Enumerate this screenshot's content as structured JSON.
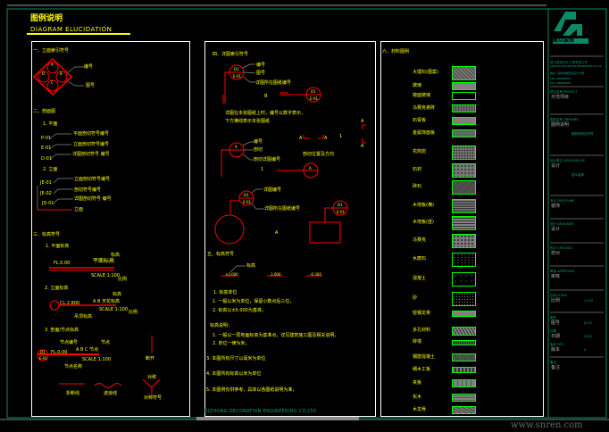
{
  "title": {
    "cn": "图例说明",
    "en": "DIAGRAM ELUCIDATION"
  },
  "left": {
    "s1": "一、立面索引符号",
    "s1_labels": [
      "编号",
      "图号"
    ],
    "diamond": [
      "A",
      "B",
      "C",
      "D",
      "E-01",
      "E-02",
      "E-03",
      "E-04"
    ],
    "s2": "二、剖面图",
    "s2_plan": "1. 平面",
    "plan_codes": [
      "P-01",
      "E-01",
      "D-01"
    ],
    "plan_labels": [
      "平面剖切符号编号",
      "立面剖切符号编号",
      "详图剖切符号 编号"
    ],
    "s2_elev": "2. 立面",
    "elev_codes": [
      "JE-01",
      "JE-02",
      "JD-01"
    ],
    "elev_labels": [
      "立面剖切符号编号",
      "剖切符号编号",
      "详图剖切符号 编号"
    ],
    "elev_last": "立面",
    "s3": "三、标高符号",
    "lv1": "1. 平面标高",
    "lv1_val": "FL.0.00",
    "lv1_mark": "平面标高",
    "lv1_note": "标高",
    "lv1_sub": "SCALE 1:100",
    "lv1_r": "比例",
    "lv2": "2. 立面标高",
    "lv2_val": "CL.2.800",
    "lv2_mark": "A  B  天花标高",
    "lv2_note": "标高",
    "lv2_sub": "SCALE 1:100",
    "lv2_r": "比例",
    "lv2_l": "吊顶标高",
    "lv3": "3. 剖面/节点标高",
    "lv3_code": "D1",
    "lv3_code2": "E-01",
    "lv3_val": "FL.0.00",
    "lv3_mark": "A  B  C  节点",
    "lv3_note": "节点",
    "lv3_sub": "SCALE 1:100",
    "lv3_l": "节点编号",
    "lv3_r": "节点名称",
    "side": "断开",
    "sym": [
      "折断线",
      "波浪线",
      "对称符号"
    ],
    "sym_top": "对称"
  },
  "middle": {
    "s4": "四、详图索引符号",
    "idx_code": "D1",
    "idx_page": "E-01",
    "idx_labels": [
      "编号",
      "图号",
      "详图所在图纸编号"
    ],
    "idx_b": "B",
    "note1": "详图在本张图纸上时，编号以数字表示，",
    "note2": "下方横线表示本张图纸",
    "sec_code": "A",
    "sec_labels": [
      "编号",
      "剖切",
      "剖切详图编号"
    ],
    "sec_num": "1",
    "cut_a": "A",
    "cut_b": "A",
    "cut_n": "1",
    "cut_note": "剖切位置及方向",
    "side_a": "A",
    "side_b": "A",
    "det_code": "D1",
    "det_page": "E-01",
    "det_labels": [
      "详图编号",
      "详图所在图纸编号"
    ],
    "circle_a": "A",
    "s5": "五、标高符号",
    "lv_note": "标高",
    "lv_vals": [
      "±0.000",
      "3.000",
      "-0.300"
    ],
    "n_head": "1. 标高单位",
    "n1": "1. 一般以米为单位，保留小数点后三位，",
    "n2": "2. 标高以±0.000为基准，",
    "m_head": "标高说明：",
    "m1": "1. 一般以一层地面标高为基准点，详见建筑施工图及相关说明，",
    "m2": "2. 单位一律为米，",
    "p3": "3. 本图所有尺寸以毫米为单位",
    "p4": "4. 本图所有标高以米为单位",
    "p5": "5. 本图例仅供参考，具体以各图纸说明为准，",
    "company": "JUZHONG DECORATION ENGINEERING  CO.LTD"
  },
  "right": {
    "s6": "六、材料图例",
    "materials": [
      "大理石(图案)",
      "玻璃",
      "镜面玻璃",
      "马赛克瓷砖",
      "石膏板",
      "金属饰面板",
      "花岗岩",
      "石材",
      "碎石",
      "木地板(横)",
      "木地板(竖)",
      "马赛克",
      "水磨石",
      "混凝土",
      "砂",
      "轻钢龙骨",
      "多孔材料",
      "砖墙",
      "钢筋混凝土",
      "细木工板",
      "夹板",
      "实木",
      "木龙骨"
    ]
  },
  "titleblock": {
    "company_cn": "聚众装饰",
    "company_line": "居众装饰设计工程有限公司",
    "company_en": "JUZHONG DECORATION ENGINEERING CO.,LTD",
    "addr": "地址: 深圳市福田区设计大厦",
    "tel": "TEL: 88888888",
    "fax": "FAX: 88888888",
    "f1_label": "项目名称 PROJECT",
    "f1_value": "示范项目",
    "f2_label": "图纸名称 DRAWING",
    "f2_value": "图例说明",
    "f2_center": "图例说明及符号",
    "f3_label": "设计单位 DESIGNED BY",
    "f3_value": "设计",
    "f3_center": "居众装饰",
    "f4_label": "专业 DISCIPLINE",
    "f4_value": "装饰",
    "f5_label": "设计 DESIGNER",
    "f5_value": "设计",
    "f6_label": "校对 CHECKED",
    "f6_value": "校对",
    "f7_label": "审核 APPROVED",
    "f7_value": "审核",
    "f8_label": "比例 SCALE",
    "f8_value": "比例",
    "f8_right": "1:100",
    "f9_label": "图号",
    "f9_value": "图号",
    "f9_right": "JZ-01",
    "f10_label": "日期",
    "f10_value": "日期",
    "f10_right": "2010",
    "f11_label": "版本 REV",
    "f11_value": "版本",
    "f11_right": "A",
    "f12_label": "备注",
    "f12_value": "备注"
  },
  "watermark": "www.snren.com",
  "colors": {
    "text": "#ffff00",
    "symbol": "#ff0000",
    "hatch_border": "#00ff00",
    "frame": "#0aa37a",
    "panel": "#ffffff"
  }
}
